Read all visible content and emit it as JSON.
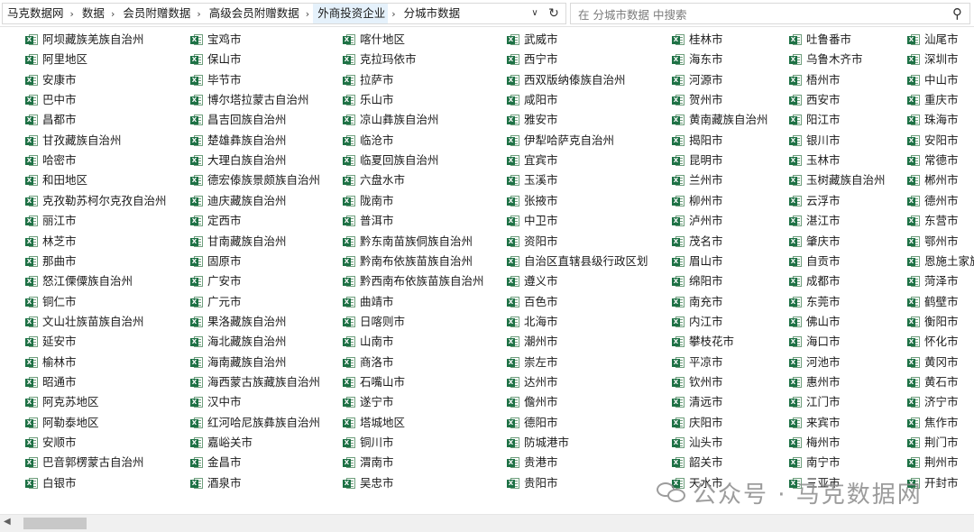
{
  "breadcrumb": [
    "马克数据网",
    "数据",
    "会员附赠数据",
    "高级会员附赠数据",
    "外商投资企业",
    "分城市数据"
  ],
  "search": {
    "placeholder": "在 分城市数据 中搜索"
  },
  "watermark": "公众号 · 马克数据网",
  "columns": [
    [
      "阿坝藏族羌族自治州",
      "阿里地区",
      "安康市",
      "巴中市",
      "昌都市",
      "甘孜藏族自治州",
      "哈密市",
      "和田地区",
      "克孜勒苏柯尔克孜自治州",
      "丽江市",
      "林芝市",
      "那曲市",
      "怒江傈僳族自治州",
      "铜仁市",
      "文山壮族苗族自治州",
      "延安市",
      "榆林市",
      "昭通市",
      "阿克苏地区",
      "阿勒泰地区",
      "安顺市",
      "巴音郭楞蒙古自治州",
      "白银市"
    ],
    [
      "宝鸡市",
      "保山市",
      "毕节市",
      "博尔塔拉蒙古自治州",
      "昌吉回族自治州",
      "楚雄彝族自治州",
      "大理白族自治州",
      "德宏傣族景颇族自治州",
      "迪庆藏族自治州",
      "定西市",
      "甘南藏族自治州",
      "固原市",
      "广安市",
      "广元市",
      "果洛藏族自治州",
      "海北藏族自治州",
      "海南藏族自治州",
      "海西蒙古族藏族自治州",
      "汉中市",
      "红河哈尼族彝族自治州",
      "嘉峪关市",
      "金昌市",
      "酒泉市"
    ],
    [
      "喀什地区",
      "克拉玛依市",
      "拉萨市",
      "乐山市",
      "凉山彝族自治州",
      "临沧市",
      "临夏回族自治州",
      "六盘水市",
      "陇南市",
      "普洱市",
      "黔东南苗族侗族自治州",
      "黔南布依族苗族自治州",
      "黔西南布依族苗族自治州",
      "曲靖市",
      "日喀则市",
      "山南市",
      "商洛市",
      "石嘴山市",
      "遂宁市",
      "塔城地区",
      "铜川市",
      "渭南市",
      "吴忠市"
    ],
    [
      "武威市",
      "西宁市",
      "西双版纳傣族自治州",
      "咸阳市",
      "雅安市",
      "伊犁哈萨克自治州",
      "宜宾市",
      "玉溪市",
      "张掖市",
      "中卫市",
      "资阳市",
      "自治区直辖县级行政区划",
      "遵义市",
      "百色市",
      "北海市",
      "潮州市",
      "崇左市",
      "达州市",
      "儋州市",
      "德阳市",
      "防城港市",
      "贵港市",
      "贵阳市"
    ],
    [
      "桂林市",
      "海东市",
      "河源市",
      "贺州市",
      "黄南藏族自治州",
      "揭阳市",
      "昆明市",
      "兰州市",
      "柳州市",
      "泸州市",
      "茂名市",
      "眉山市",
      "绵阳市",
      "南充市",
      "内江市",
      "攀枝花市",
      "平凉市",
      "钦州市",
      "清远市",
      "庆阳市",
      "汕头市",
      "韶关市",
      "天水市"
    ],
    [
      "吐鲁番市",
      "乌鲁木齐市",
      "梧州市",
      "西安市",
      "阳江市",
      "银川市",
      "玉林市",
      "玉树藏族自治州",
      "云浮市",
      "湛江市",
      "肇庆市",
      "自贡市",
      "成都市",
      "东莞市",
      "佛山市",
      "海口市",
      "河池市",
      "惠州市",
      "江门市",
      "来宾市",
      "梅州市",
      "南宁市",
      "三亚市"
    ],
    [
      "汕尾市",
      "深圳市",
      "中山市",
      "重庆市",
      "珠海市",
      "安阳市",
      "常德市",
      "郴州市",
      "德州市",
      "东营市",
      "鄂州市",
      "恩施土家族",
      "菏泽市",
      "鹤壁市",
      "衡阳市",
      "怀化市",
      "黄冈市",
      "黄石市",
      "济宁市",
      "焦作市",
      "荆门市",
      "荆州市",
      "开封市"
    ]
  ]
}
